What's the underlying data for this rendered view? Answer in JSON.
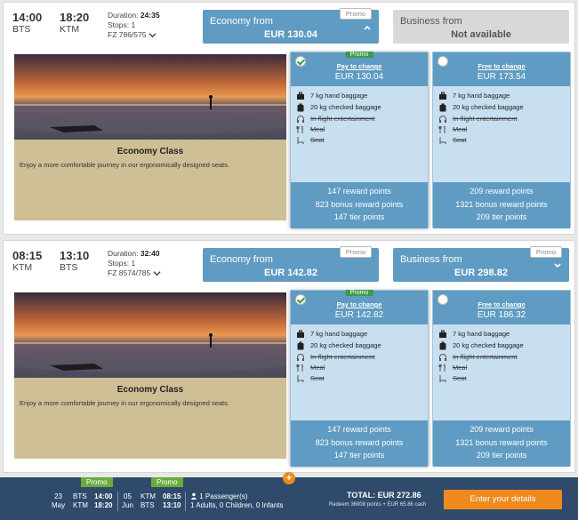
{
  "flights": [
    {
      "dep_time": "14:00",
      "dep_airport": "BTS",
      "arr_time": "18:20",
      "arr_airport": "KTM",
      "duration_label": "Duration:",
      "duration": "24:35",
      "stops": "Stops: 1",
      "flight_no": "FZ 786/575",
      "economy": {
        "label": "Economy from",
        "price": "EUR 130.04",
        "promo": "Promo",
        "expanded": true
      },
      "business": {
        "label": "Business from",
        "price": "Not available",
        "available": false
      },
      "class_title": "Economy Class",
      "class_desc": "Enjoy a more comfortable journey in our ergonomically designed seats.",
      "cards": [
        {
          "selected": true,
          "promo": "Promo",
          "change": "Pay to change",
          "price": "EUR 130.04",
          "features": [
            {
              "icon": "hand-baggage-icon",
              "text": "7 kg hand baggage",
              "included": true
            },
            {
              "icon": "checked-baggage-icon",
              "text": "20 kg checked baggage",
              "included": true
            },
            {
              "icon": "headphones-icon",
              "text": "In-flight entertainment",
              "included": false
            },
            {
              "icon": "meal-icon",
              "text": "Meal",
              "included": false
            },
            {
              "icon": "seat-icon",
              "text": "Seat",
              "included": false
            }
          ],
          "points": [
            "147 reward points",
            "823 bonus reward points",
            "147 tier points"
          ]
        },
        {
          "selected": false,
          "promo": "",
          "change": "Free to change",
          "price": "EUR 173.54",
          "features": [
            {
              "icon": "hand-baggage-icon",
              "text": "7 kg hand baggage",
              "included": true
            },
            {
              "icon": "checked-baggage-icon",
              "text": "20 kg checked baggage",
              "included": true
            },
            {
              "icon": "headphones-icon",
              "text": "In-flight entertainment",
              "included": false
            },
            {
              "icon": "meal-icon",
              "text": "Meal",
              "included": false
            },
            {
              "icon": "seat-icon",
              "text": "Seat",
              "included": false
            }
          ],
          "points": [
            "209 reward points",
            "1321 bonus reward points",
            "209 tier points"
          ]
        }
      ]
    },
    {
      "dep_time": "08:15",
      "dep_airport": "KTM",
      "arr_time": "13:10",
      "arr_airport": "BTS",
      "duration_label": "Duration:",
      "duration": "32:40",
      "stops": "Stops: 1",
      "flight_no": "FZ 8574/785",
      "economy": {
        "label": "Economy from",
        "price": "EUR 142.82",
        "promo": "Promo",
        "expanded": true
      },
      "business": {
        "label": "Business from",
        "price": "EUR 298.82",
        "promo": "Promo",
        "available": true
      },
      "class_title": "Economy Class",
      "class_desc": "Enjoy a more comfortable journey in our ergonomically designed seats.",
      "cards": [
        {
          "selected": true,
          "promo": "Promo",
          "change": "Pay to change",
          "price": "EUR 142.82",
          "features": [
            {
              "icon": "hand-baggage-icon",
              "text": "7 kg hand baggage",
              "included": true
            },
            {
              "icon": "checked-baggage-icon",
              "text": "20 kg checked baggage",
              "included": true
            },
            {
              "icon": "headphones-icon",
              "text": "In-flight entertainment",
              "included": false
            },
            {
              "icon": "meal-icon",
              "text": "Meal",
              "included": false
            },
            {
              "icon": "seat-icon",
              "text": "Seat",
              "included": false
            }
          ],
          "points": [
            "147 reward points",
            "823 bonus reward points",
            "147 tier points"
          ]
        },
        {
          "selected": false,
          "promo": "",
          "change": "Free to change",
          "price": "EUR 186.32",
          "features": [
            {
              "icon": "hand-baggage-icon",
              "text": "7 kg hand baggage",
              "included": true
            },
            {
              "icon": "checked-baggage-icon",
              "text": "20 kg checked baggage",
              "included": true
            },
            {
              "icon": "headphones-icon",
              "text": "In-flight entertainment",
              "included": false
            },
            {
              "icon": "meal-icon",
              "text": "Meal",
              "included": false
            },
            {
              "icon": "seat-icon",
              "text": "Seat",
              "included": false
            }
          ],
          "points": [
            "209 reward points",
            "1321 bonus reward points",
            "209 tier points"
          ]
        }
      ]
    }
  ],
  "footer": {
    "leg1": {
      "promo": "Promo",
      "day": "23",
      "month": "May",
      "from": "BTS",
      "to": "KTM",
      "dep": "14:00",
      "arr": "18:20"
    },
    "leg2": {
      "promo": "Promo",
      "day": "05",
      "month": "Jun",
      "from": "KTM",
      "to": "BTS",
      "dep": "08:15",
      "arr": "13:10"
    },
    "passengers": "1 Passenger(s)",
    "passenger_detail": "1 Adults, 0 Children, 0 Infants",
    "total": "TOTAL: EUR 272.86",
    "redeem": "Redeem 36908 points + EUR 65.86 cash",
    "cta": "Enter your details"
  },
  "colors": {
    "primary": "#5f9bc2",
    "card": "#c8dff0",
    "accent": "#f08a1c",
    "promo": "#3d9b47",
    "footer": "#2f4a6b"
  }
}
